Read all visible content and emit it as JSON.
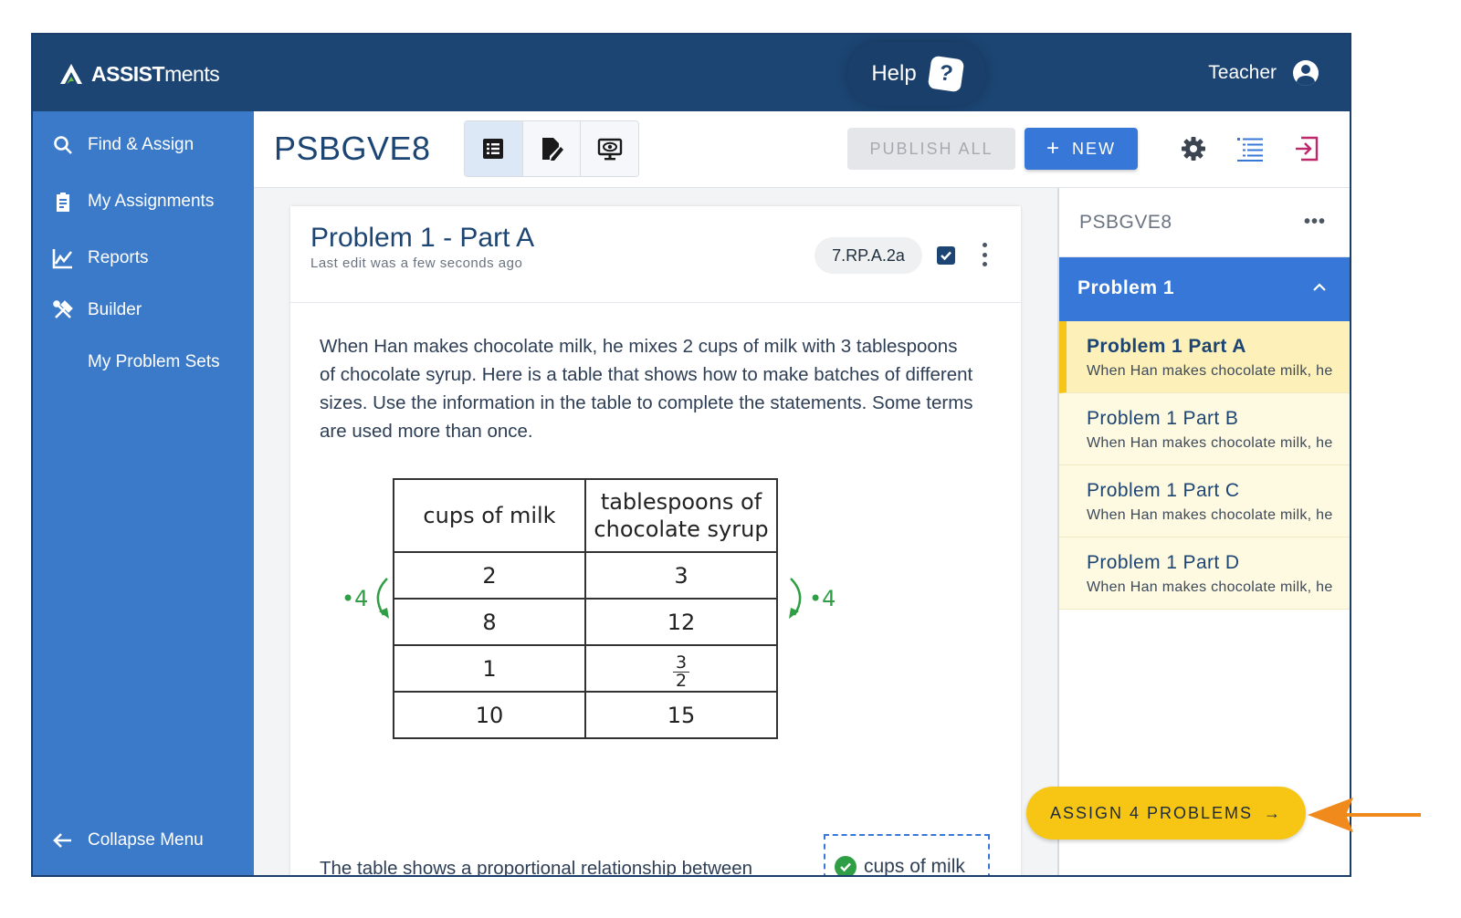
{
  "app": {
    "logo_bold": "ASSIST",
    "logo_light": "ments",
    "help_label": "Help",
    "user_label": "Teacher"
  },
  "sidebar": {
    "items": [
      {
        "label": "Find & Assign",
        "icon": "search-icon"
      },
      {
        "label": "My Assignments",
        "icon": "clipboard-icon"
      },
      {
        "label": "Reports",
        "icon": "chart-icon"
      },
      {
        "label": "Builder",
        "icon": "tools-icon"
      },
      {
        "label": "My Problem Sets",
        "icon": ""
      }
    ],
    "collapse_label": "Collapse Menu"
  },
  "toolbar": {
    "title": "PSBGVE8",
    "publish_label": "PUBLISH ALL",
    "new_label": "NEW",
    "views": [
      "list-view-icon",
      "edit-view-icon",
      "preview-view-icon"
    ],
    "icons": [
      "gear-icon",
      "outline-list-icon",
      "exit-icon"
    ]
  },
  "problem": {
    "title": "Problem 1 - Part A",
    "last_edit": "Last edit was a few seconds ago",
    "standard": "7.RP.A.2a",
    "text": "When Han makes chocolate milk, he mixes 2 cups of milk with 3 tablespoons of chocolate syrup. Here is a table that shows how to make batches of different sizes. Use the information in the table to complete the statements. Some terms are used more than once.",
    "table": {
      "headers": [
        "cups of milk",
        "tablespoons of chocolate syrup"
      ],
      "rows": [
        [
          "2",
          "3"
        ],
        [
          "8",
          "12"
        ],
        [
          "1",
          "3/2"
        ],
        [
          "10",
          "15"
        ]
      ],
      "frac_num": "3",
      "frac_den": "2",
      "left_arrow_label": "•4",
      "right_arrow_label": "•4"
    },
    "bottom_text": "The table shows a proportional relationship between",
    "answer": "cups of milk"
  },
  "right_panel": {
    "title": "PSBGVE8",
    "more": "•••",
    "group_title": "Problem 1",
    "items": [
      {
        "title": "Problem 1 Part A",
        "snippet": "When Han makes chocolate milk, he",
        "active": true
      },
      {
        "title": "Problem 1 Part B",
        "snippet": "When Han makes chocolate milk, he",
        "active": false
      },
      {
        "title": "Problem 1 Part C",
        "snippet": "When Han makes chocolate milk, he",
        "active": false
      },
      {
        "title": "Problem 1 Part D",
        "snippet": "When Han makes chocolate milk, he",
        "active": false
      }
    ]
  },
  "assign": {
    "label": "ASSIGN 4 PROBLEMS",
    "arrow": "→"
  },
  "colors": {
    "topbar": "#1c4573",
    "sidebar": "#3b7ac9",
    "primary": "#3677d8",
    "assign": "#f7c614",
    "annotation": "#f08a1c"
  }
}
